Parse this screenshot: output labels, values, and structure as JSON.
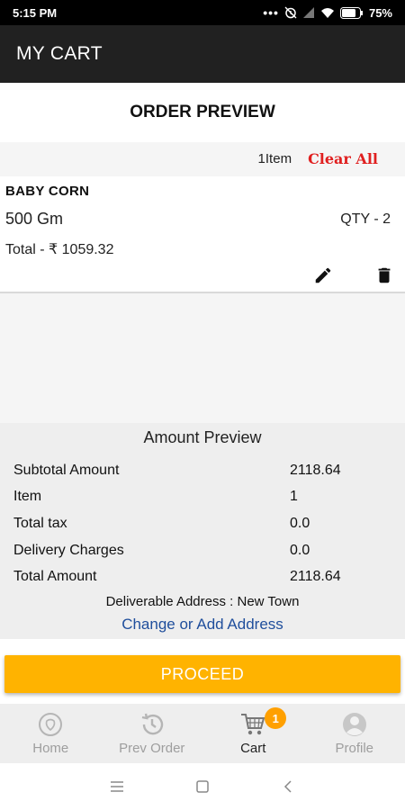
{
  "status_bar": {
    "time": "5:15 PM",
    "battery": "75%"
  },
  "app_bar": {
    "title": "MY CART"
  },
  "order_preview": {
    "title": "ORDER PREVIEW"
  },
  "cart_summary": {
    "item_count": "1Item",
    "clear_all": "Clear All"
  },
  "cart_items": [
    {
      "name": "BABY CORN",
      "weight": "500 Gm",
      "qty": "QTY - 2",
      "total": "Total - ₹  1059.32"
    }
  ],
  "amount_preview": {
    "title": "Amount Preview",
    "rows": [
      {
        "label": "Subtotal Amount",
        "value": "2118.64"
      },
      {
        "label": "Item",
        "value": "1"
      },
      {
        "label": "Total tax",
        "value": "0.0"
      },
      {
        "label": "Delivery Charges",
        "value": "0.0"
      },
      {
        "label": "Total Amount",
        "value": "2118.64"
      }
    ],
    "address": "Deliverable Address : New Town",
    "change_address": "Change or Add Address"
  },
  "proceed_label": "PROCEED",
  "bottom_nav": {
    "items": [
      {
        "label": "Home",
        "icon": "home-icon"
      },
      {
        "label": "Prev Order",
        "icon": "history-icon"
      },
      {
        "label": "Cart",
        "icon": "cart-icon",
        "badge": "1"
      },
      {
        "label": "Profile",
        "icon": "profile-icon"
      }
    ],
    "active_index": 2
  },
  "colors": {
    "app_bar": "#212121",
    "clear_all": "#e01f1f",
    "link": "#1f4e9c",
    "proceed": "#ffb300",
    "badge": "#ffa000"
  }
}
